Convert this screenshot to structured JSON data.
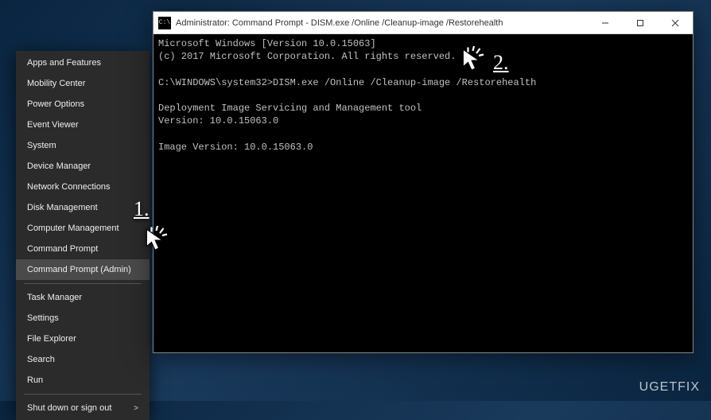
{
  "winx": {
    "groups": [
      [
        "Apps and Features",
        "Mobility Center",
        "Power Options",
        "Event Viewer",
        "System",
        "Device Manager",
        "Network Connections",
        "Disk Management",
        "Computer Management",
        "Command Prompt",
        "Command Prompt (Admin)"
      ],
      [
        "Task Manager",
        "Settings",
        "File Explorer",
        "Search",
        "Run"
      ],
      [
        "Shut down or sign out"
      ]
    ],
    "highlighted": "Command Prompt (Admin)"
  },
  "cmd": {
    "title": "Administrator: Command Prompt - DISM.exe  /Online /Cleanup-image /Restorehealth",
    "lines": [
      "Microsoft Windows [Version 10.0.15063]",
      "(c) 2017 Microsoft Corporation. All rights reserved.",
      "",
      "C:\\WINDOWS\\system32>DISM.exe /Online /Cleanup-image /Restorehealth",
      "",
      "Deployment Image Servicing and Management tool",
      "Version: 10.0.15063.0",
      "",
      "Image Version: 10.0.15063.0",
      ""
    ]
  },
  "annotations": {
    "one": "1.",
    "two": "2."
  },
  "watermark": "UGETFIX"
}
